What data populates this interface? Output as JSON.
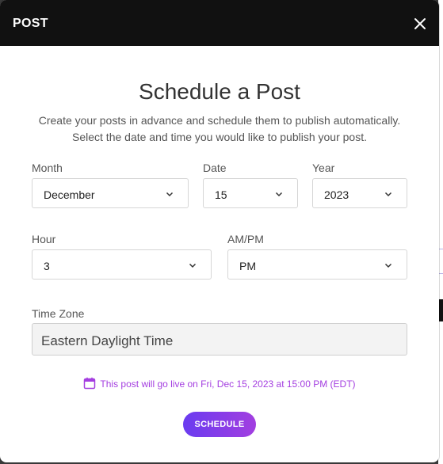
{
  "header": {
    "title": "POST"
  },
  "content": {
    "heading": "Schedule a Post",
    "subtitle_line1": "Create your posts in advance and schedule them to publish automatically.",
    "subtitle_line2": "Select the date and time you would like to publish your post."
  },
  "fields": {
    "month": {
      "label": "Month",
      "value": "December"
    },
    "date": {
      "label": "Date",
      "value": "15"
    },
    "year": {
      "label": "Year",
      "value": "2023"
    },
    "hour": {
      "label": "Hour",
      "value": "3"
    },
    "ampm": {
      "label": "AM/PM",
      "value": "PM"
    },
    "timezone": {
      "label": "Time Zone",
      "value": "Eastern Daylight Time"
    }
  },
  "live_note": "This post will go live on Fri, Dec 15, 2023 at 15:00 PM (EDT)",
  "schedule_button": "SCHEDULE",
  "icons": {
    "close": "close-icon",
    "chevron": "chevron-down-icon",
    "calendar": "calendar-icon"
  },
  "colors": {
    "header_bg": "#111111",
    "accent_purple": "#a43ee0",
    "button_gradient_start": "#6a3cf0",
    "button_gradient_end": "#a23ee0"
  }
}
